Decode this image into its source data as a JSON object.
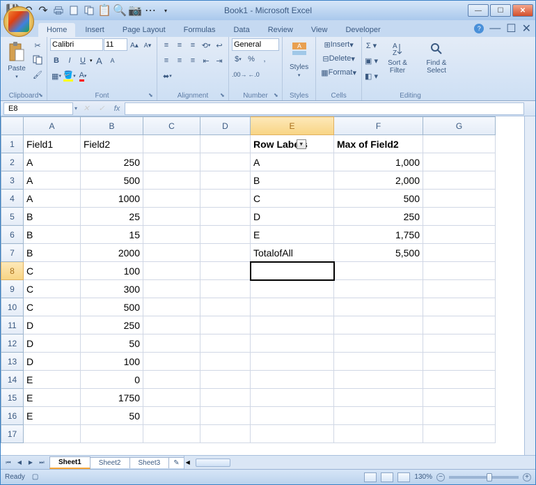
{
  "window": {
    "title": "Book1 - Microsoft Excel"
  },
  "ribbon": {
    "tabs": [
      "Home",
      "Insert",
      "Page Layout",
      "Formulas",
      "Data",
      "Review",
      "View",
      "Developer"
    ],
    "groups": {
      "clipboard": {
        "label": "Clipboard",
        "paste": "Paste"
      },
      "font": {
        "label": "Font",
        "name": "Calibri",
        "size": "11"
      },
      "alignment": {
        "label": "Alignment"
      },
      "number": {
        "label": "Number",
        "format": "General"
      },
      "styles": {
        "label": "Styles",
        "btn": "Styles"
      },
      "cells": {
        "label": "Cells",
        "insert": "Insert",
        "delete": "Delete",
        "format": "Format"
      },
      "editing": {
        "label": "Editing",
        "sort": "Sort & Filter",
        "find": "Find & Select"
      }
    }
  },
  "namebox": "E8",
  "columns": [
    "A",
    "B",
    "C",
    "D",
    "E",
    "F",
    "G"
  ],
  "rows": [
    "1",
    "2",
    "3",
    "4",
    "5",
    "6",
    "7",
    "8",
    "9",
    "10",
    "11",
    "12",
    "13",
    "14",
    "15",
    "16",
    "17"
  ],
  "active_cell": "E8",
  "cells": {
    "A1": {
      "v": "Field1"
    },
    "B1": {
      "v": "Field2"
    },
    "A2": {
      "v": "A"
    },
    "B2": {
      "v": "250",
      "num": true
    },
    "A3": {
      "v": "A"
    },
    "B3": {
      "v": "500",
      "num": true
    },
    "A4": {
      "v": "A"
    },
    "B4": {
      "v": "1000",
      "num": true
    },
    "A5": {
      "v": "B"
    },
    "B5": {
      "v": "25",
      "num": true
    },
    "A6": {
      "v": "B"
    },
    "B6": {
      "v": "15",
      "num": true
    },
    "A7": {
      "v": "B"
    },
    "B7": {
      "v": "2000",
      "num": true
    },
    "A8": {
      "v": "C"
    },
    "B8": {
      "v": "100",
      "num": true
    },
    "A9": {
      "v": "C"
    },
    "B9": {
      "v": "300",
      "num": true
    },
    "A10": {
      "v": "C"
    },
    "B10": {
      "v": "500",
      "num": true
    },
    "A11": {
      "v": "D"
    },
    "B11": {
      "v": "250",
      "num": true
    },
    "A12": {
      "v": "D"
    },
    "B12": {
      "v": "50",
      "num": true
    },
    "A13": {
      "v": "D"
    },
    "B13": {
      "v": "100",
      "num": true
    },
    "A14": {
      "v": "E"
    },
    "B14": {
      "v": "0",
      "num": true
    },
    "A15": {
      "v": "E"
    },
    "B15": {
      "v": "1750",
      "num": true
    },
    "A16": {
      "v": "E"
    },
    "B16": {
      "v": "50",
      "num": true
    },
    "E1": {
      "v": "Row Labels",
      "bold": true,
      "filter": true
    },
    "F1": {
      "v": "Max of Field2",
      "bold": true
    },
    "E2": {
      "v": "A"
    },
    "F2": {
      "v": "1,000",
      "num": true
    },
    "E3": {
      "v": "B"
    },
    "F3": {
      "v": "2,000",
      "num": true
    },
    "E4": {
      "v": "C"
    },
    "F4": {
      "v": "500",
      "num": true
    },
    "E5": {
      "v": "D"
    },
    "F5": {
      "v": "250",
      "num": true
    },
    "E6": {
      "v": "E"
    },
    "F6": {
      "v": "1,750",
      "num": true
    },
    "E7": {
      "v": "TotalofAll"
    },
    "F7": {
      "v": "5,500",
      "num": true
    }
  },
  "sheets": [
    "Sheet1",
    "Sheet2",
    "Sheet3"
  ],
  "status": {
    "ready": "Ready",
    "zoom": "130%"
  }
}
